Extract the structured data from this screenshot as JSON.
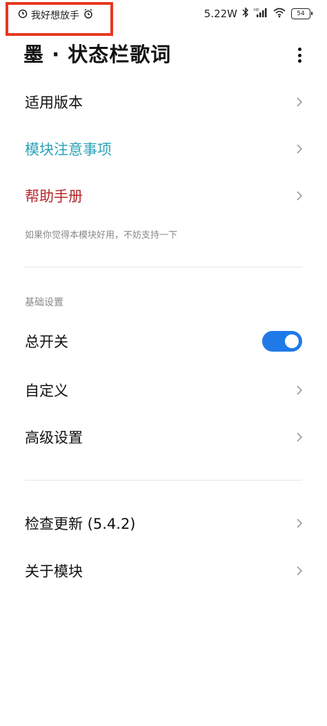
{
  "status_bar": {
    "carrier_text": "我好想放手",
    "power": "5.22W",
    "battery_level": "54",
    "icons": [
      "clock-spiral-icon",
      "alarm-icon",
      "bluetooth-icon",
      "hd-signal-icon",
      "wifi-icon",
      "battery-icon"
    ],
    "highlight_color": "#e8381e"
  },
  "appbar": {
    "title": "墨 · 状态栏歌词",
    "menu_icon": "more-vertical-icon"
  },
  "menu": {
    "applicable_version": "适用版本",
    "module_notes": "模块注意事项",
    "help_manual": "帮助手册",
    "support_note": "如果你觉得本模块好用，不妨支持一下"
  },
  "basic_settings": {
    "section_title": "基础设置",
    "master_switch": "总开关",
    "master_switch_on": true,
    "customize": "自定义",
    "advanced": "高级设置"
  },
  "about": {
    "check_update": "检查更新 (5.4.2)",
    "about_module": "关于模块"
  },
  "colors": {
    "accent_blue": "#1f7ae8",
    "teal_link": "#2aa3b8",
    "red_link": "#b5252a"
  }
}
